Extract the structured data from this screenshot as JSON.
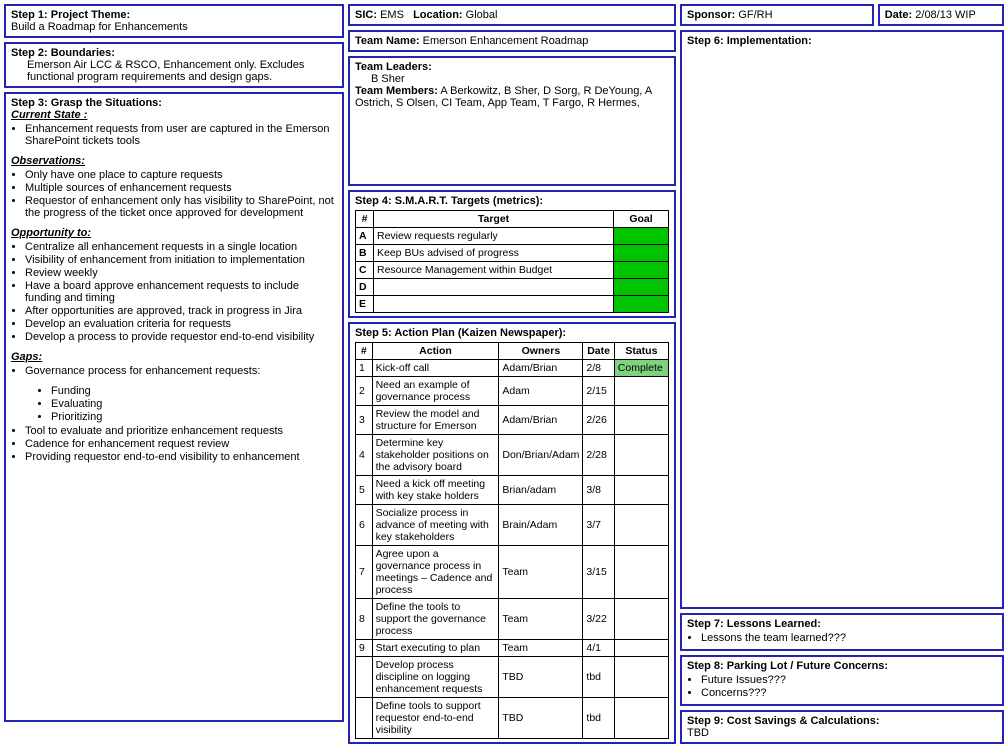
{
  "step1": {
    "title": "Step 1: Project Theme:",
    "body": "Build a Roadmap for Enhancements"
  },
  "step2": {
    "title": "Step 2: Boundaries:",
    "body": "Emerson Air LCC & RSCO, Enhancement only.  Excludes functional program requirements and design gaps."
  },
  "step3": {
    "title": "Step 3: Grasp the Situations:",
    "cs_label": "Current State :",
    "cs": [
      "Enhancement requests from user are captured in the Emerson SharePoint tickets tools"
    ],
    "obs_label": "Observations:",
    "obs": [
      "Only have one place to capture requests",
      "Multiple sources of enhancement requests",
      "Requestor of enhancement only has visibility to SharePoint, not the progress of the ticket once approved for development"
    ],
    "opp_label": "Opportunity to:",
    "opp": [
      "Centralize all enhancement requests in a single location",
      "Visibility of enhancement from initiation to implementation",
      "Review weekly",
      "Have a board approve  enhancement requests to include funding and timing",
      "After opportunities are approved, track in progress in Jira",
      "Develop an evaluation criteria for requests",
      "Develop a process to provide requestor end-to-end visibility"
    ],
    "gaps_label": "Gaps:",
    "gaps_top": "Governance process for enhancement requests:",
    "gaps_sub": [
      "Funding",
      "Evaluating",
      "Prioritizing"
    ],
    "gaps_rest": [
      "Tool to evaluate and prioritize enhancement requests",
      "Cadence for enhancement request review",
      "Providing requestor end-to-end visibility to enhancement"
    ]
  },
  "header": {
    "sic_label": "SIC:",
    "sic_val": "EMS",
    "loc_label": "Location:",
    "loc_val": "Global",
    "sponsor_label": "Sponsor:",
    "sponsor_val": "GF/RH",
    "date_label": "Date:",
    "date_val": "2/08/13 WIP",
    "team_name_label": "Team Name:",
    "team_name_val": "Emerson Enhancement Roadmap",
    "leaders_label": "Team Leaders:",
    "leaders_val": "B Sher",
    "members_label": "Team Members:",
    "members_val": "A Berkowitz, B Sher, D Sorg, R DeYoung, A Ostrich,  S Olsen, CI Team, App Team, T Fargo, R Hermes,"
  },
  "step4": {
    "title": "Step 4: S.M.A.R.T. Targets  (metrics):",
    "h1": "#",
    "h2": "Target",
    "h3": "Goal",
    "rows": [
      {
        "id": "A",
        "target": "Review requests regularly",
        "goal": ""
      },
      {
        "id": "B",
        "target": "Keep BUs advised of progress",
        "goal": ""
      },
      {
        "id": "C",
        "target": "Resource Management within Budget",
        "goal": ""
      },
      {
        "id": "D",
        "target": "",
        "goal": ""
      },
      {
        "id": "E",
        "target": "",
        "goal": ""
      }
    ]
  },
  "step5": {
    "title": "Step 5: Action Plan (Kaizen Newspaper):",
    "h1": "#",
    "h2": "Action",
    "h3": "Owners",
    "h4": "Date",
    "h5": "Status",
    "rows": [
      {
        "n": "1",
        "action": "Kick-off call",
        "owners": "Adam/Brian",
        "date": "2/8",
        "status": "Complete",
        "green": true
      },
      {
        "n": "2",
        "action": "Need an example of governance process",
        "owners": "Adam",
        "date": "2/15",
        "status": ""
      },
      {
        "n": "3",
        "action": "Review the model and structure for Emerson",
        "owners": "Adam/Brian",
        "date": "2/26",
        "status": ""
      },
      {
        "n": "4",
        "action": "Determine key stakeholder positions on the advisory board",
        "owners": "Don/Brian/Adam",
        "date": "2/28",
        "status": ""
      },
      {
        "n": "5",
        "action": "Need a kick off meeting with key stake holders",
        "owners": "Brian/adam",
        "date": "3/8",
        "status": ""
      },
      {
        "n": "6",
        "action": "Socialize process in advance of meeting with key stakeholders",
        "owners": "Brain/Adam",
        "date": "3/7",
        "status": ""
      },
      {
        "n": "7",
        "action": "Agree upon a governance process in meetings – Cadence and process",
        "owners": "Team",
        "date": "3/15",
        "status": ""
      },
      {
        "n": "8",
        "action": "Define the tools to support the governance process",
        "owners": "Team",
        "date": "3/22",
        "status": ""
      },
      {
        "n": "9",
        "action": "Start executing to plan",
        "owners": "Team",
        "date": "4/1",
        "status": ""
      },
      {
        "n": "",
        "action": "Develop process discipline on logging enhancement requests",
        "owners": "TBD",
        "date": "tbd",
        "status": ""
      },
      {
        "n": "",
        "action": "Define tools to support requestor end-to-end visibility",
        "owners": "TBD",
        "date": "tbd",
        "status": ""
      }
    ]
  },
  "step6": {
    "title": "Step 6: Implementation:"
  },
  "step7": {
    "title": "Step 7: Lessons Learned:",
    "items": [
      "Lessons the team learned???"
    ]
  },
  "step8": {
    "title": "Step 8: Parking Lot / Future Concerns:",
    "items": [
      "Future Issues???",
      "Concerns???"
    ]
  },
  "step9": {
    "title": "Step 9: Cost Savings & Calculations:",
    "body": "TBD"
  }
}
